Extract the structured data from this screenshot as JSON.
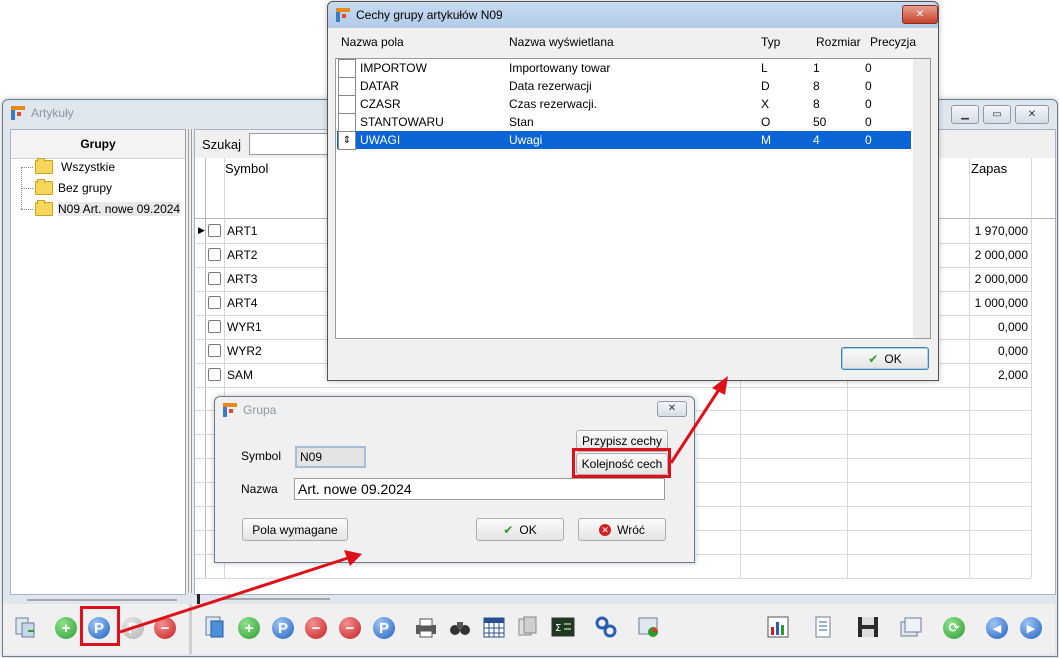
{
  "articles_window": {
    "title": "Artykuły",
    "groups_header": "Grupy",
    "groups": [
      "Wszystkie",
      "Bez grupy",
      "N09 Art. nowe 09.2024"
    ],
    "search_label": "Szukaj",
    "columns": {
      "symbol": "Symbol",
      "zapas": "Zapas"
    },
    "rows": [
      {
        "symbol": "ART1",
        "zapas": "1 970,000"
      },
      {
        "symbol": "ART2",
        "zapas": "2 000,000"
      },
      {
        "symbol": "ART3",
        "zapas": "2 000,000"
      },
      {
        "symbol": "ART4",
        "zapas": "1 000,000"
      },
      {
        "symbol": "WYR1",
        "zapas": "0,000"
      },
      {
        "symbol": "WYR2",
        "zapas": "0,000"
      },
      {
        "symbol": "SAM",
        "zapas": "2,000"
      }
    ]
  },
  "features_dialog": {
    "title": "Cechy grupy artykułów N09",
    "columns": [
      "Nazwa pola",
      "Nazwa wyświetlana",
      "Typ",
      "Rozmiar",
      "Precyzja"
    ],
    "rows": [
      {
        "field": "IMPORTOW",
        "display": "Importowany towar",
        "type": "L",
        "size": "1",
        "precision": "0"
      },
      {
        "field": "DATAR",
        "display": "Data rezerwacji",
        "type": "D",
        "size": "8",
        "precision": "0"
      },
      {
        "field": "CZASR",
        "display": "Czas rezerwacji.",
        "type": "X",
        "size": "8",
        "precision": "0"
      },
      {
        "field": "STANTOWARU",
        "display": "Stan",
        "type": "O",
        "size": "50",
        "precision": "0"
      },
      {
        "field": "UWAGI",
        "display": "Uwagi",
        "type": "M",
        "size": "4",
        "precision": "0"
      }
    ],
    "ok_label": "OK",
    "close_glyph": "✕"
  },
  "group_dialog": {
    "title": "Grupa",
    "symbol_label": "Symbol",
    "symbol_value": "N09",
    "name_label": "Nazwa",
    "name_value": "Art. nowe 09.2024",
    "assign_features_label": "Przypisz cechy",
    "features_order_label": "Kolejność cech",
    "required_fields_label": "Pola wymagane",
    "ok_label": "OK",
    "back_label": "Wróć"
  },
  "colors": {
    "highlight": "#e0101a",
    "selection": "#0a64d6",
    "accent_green": "#3aa53a"
  }
}
